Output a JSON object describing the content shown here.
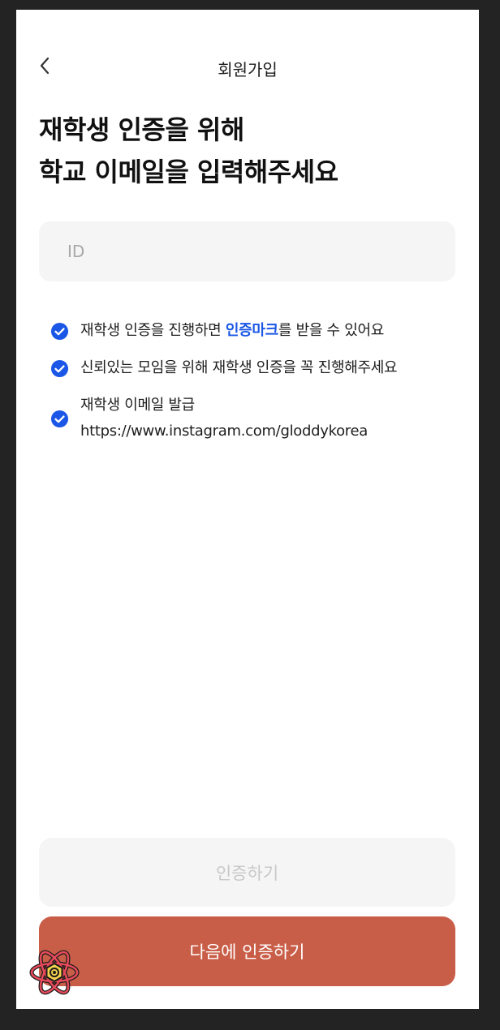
{
  "header": {
    "title": "회원가입"
  },
  "headline": {
    "line1": "재학생 인증을 위해",
    "line2": "학교 이메일을 입력해주세요"
  },
  "email_input": {
    "placeholder": "ID",
    "value": ""
  },
  "notes": [
    {
      "before": "재학생 인증을 진행하면 ",
      "highlight": "인증마크",
      "after": "를 받을 수 있어요"
    },
    {
      "text": "신뢰있는 모임을 위해 재학생 인증을 꼭 진행해주세요"
    },
    {
      "line1": "재학생 이메일 발급",
      "line2": "https://www.instagram.com/gloddykorea"
    }
  ],
  "buttons": {
    "verify": "인증하기",
    "next": "다음에 인증하기"
  },
  "colors": {
    "check": "#1b57e6",
    "highlight": "#1b57e6",
    "primary": "#c95e48",
    "disabled_bg": "#f5f5f5",
    "disabled_text": "#c8c8c8"
  },
  "icons": {
    "back": "chevron-left-icon",
    "check": "check-circle-icon",
    "overlay": "react-logo-icon"
  }
}
